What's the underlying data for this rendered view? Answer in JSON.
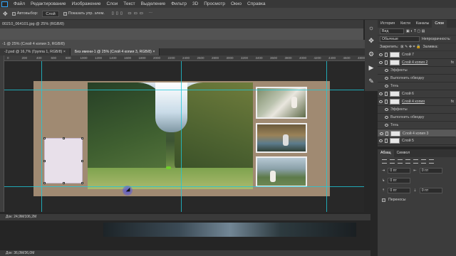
{
  "menubar": {
    "items": [
      "Файл",
      "Редактирование",
      "Изображение",
      "Слои",
      "Текст",
      "Выделение",
      "Фильтр",
      "3D",
      "Просмотр",
      "Окно",
      "Справка"
    ]
  },
  "options": {
    "autoselect": "Автовыбор:",
    "layer_select": "Слой",
    "show_controls": "Показать упр. элем."
  },
  "doc_top": {
    "title": "00210_064101.jpg @ 25% (RGB/8)"
  },
  "window": {
    "title": "-1 @ 25% (Слой 4 копия 3, RGB/8)",
    "close": "×"
  },
  "tabs": [
    {
      "label": "-2.psd @ 16,7% (Группа 1, RGB/8) ×"
    },
    {
      "label": "Без имени-1 @ 25% (Слой 4 копия 3, RGB/8) ×"
    }
  ],
  "ruler": {
    "ticks": [
      "0",
      "200",
      "400",
      "600",
      "800",
      "1000",
      "1200",
      "1400",
      "1600",
      "1800",
      "2000",
      "2200",
      "2400",
      "2600",
      "2800",
      "3000",
      "3200",
      "3400",
      "3600",
      "3800",
      "4000",
      "4200",
      "4400",
      "4600",
      "4800"
    ]
  },
  "status": {
    "doc1": "Док: 24,9M/106,2M",
    "doc2": "Док: 36,0M/36,0M"
  },
  "layers_panel": {
    "tabs": [
      "История",
      "Кисти",
      "Каналы",
      "Слои"
    ],
    "active_tab": "Слои",
    "kind_label": "Вид",
    "blend_mode": "Обычные",
    "opacity_label": "Непрозрачность:",
    "lock_label": "Закрепить:",
    "fill_label": "Заливка:",
    "layers": [
      {
        "name": "Слой 7",
        "type": "layer",
        "selected": false
      },
      {
        "name": "Слой 4 копия 2",
        "type": "layer",
        "selected": false,
        "fx": true
      },
      {
        "name": "Эффекты",
        "type": "sub"
      },
      {
        "name": "Выполнить обводку",
        "type": "sub"
      },
      {
        "name": "Тень",
        "type": "sub"
      },
      {
        "name": "Слой 6",
        "type": "layer",
        "selected": false
      },
      {
        "name": "Слой 4 копия",
        "type": "layer",
        "selected": false,
        "fx": true
      },
      {
        "name": "Эффекты",
        "type": "sub"
      },
      {
        "name": "Выполнить обводку",
        "type": "sub"
      },
      {
        "name": "Тень",
        "type": "sub"
      },
      {
        "name": "Слой 4 копия 3",
        "type": "layer",
        "selected": true
      },
      {
        "name": "Слой 5",
        "type": "layer",
        "selected": false
      }
    ]
  },
  "paragraph_panel": {
    "tabs": [
      "Абзац",
      "Символ"
    ],
    "active_tab": "Абзац",
    "fields": [
      "0 пт",
      "0 пт",
      "0 пт",
      "0 пт",
      "0 пт"
    ],
    "hyphenation": "Переносы"
  }
}
